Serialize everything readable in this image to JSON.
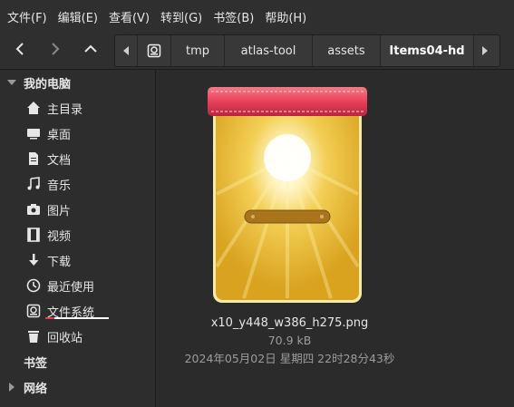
{
  "menubar": {
    "items": [
      "文件(F)",
      "编辑(E)",
      "查看(V)",
      "转到(G)",
      "书签(B)",
      "帮助(H)"
    ]
  },
  "toolbar": {
    "back_icon": "chevron-left-icon",
    "forward_icon": "chevron-right-icon",
    "up_icon": "chevron-up-icon"
  },
  "pathbar": {
    "segments": [
      "tmp",
      "atlas-tool",
      "assets",
      "Items04-hd"
    ]
  },
  "sidebar": {
    "computer_header": "我的电脑",
    "items": [
      {
        "label": "主目录",
        "icon": "home-icon"
      },
      {
        "label": "桌面",
        "icon": "desktop-icon"
      },
      {
        "label": "文档",
        "icon": "document-icon"
      },
      {
        "label": "音乐",
        "icon": "music-icon"
      },
      {
        "label": "图片",
        "icon": "camera-icon"
      },
      {
        "label": "视频",
        "icon": "film-icon"
      },
      {
        "label": "下载",
        "icon": "download-icon"
      },
      {
        "label": "最近使用",
        "icon": "clock-icon"
      },
      {
        "label": "文件系统",
        "icon": "drive-icon"
      },
      {
        "label": "回收站",
        "icon": "trash-icon"
      }
    ],
    "bookmarks_header": "书签",
    "network_header": "网络"
  },
  "file": {
    "name": "x10_y448_w386_h275.png",
    "size": "70.9 kB",
    "date": "2024年05月02日 星期四 22时28分43秒"
  },
  "colors": {
    "ribbon": "#e8405a",
    "card_gold": "#e8b830",
    "selection_underline": "#e04040"
  }
}
